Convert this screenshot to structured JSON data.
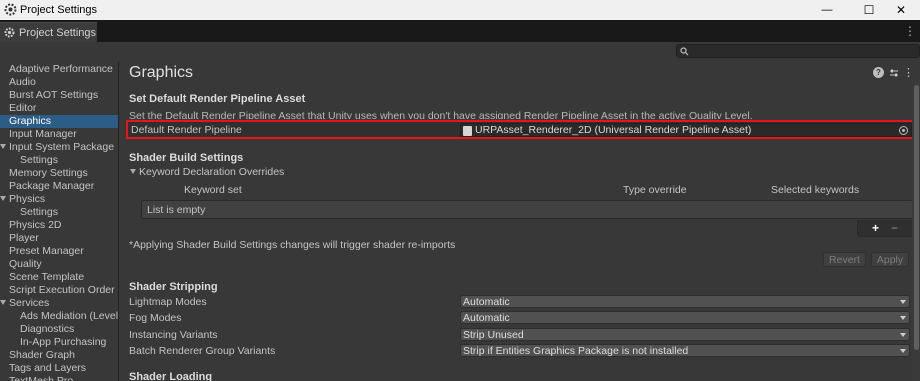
{
  "window": {
    "title": "Project Settings",
    "controls": [
      "—",
      "☐",
      "✕"
    ]
  },
  "tab": {
    "label": "Project Settings",
    "menu": "⋮"
  },
  "sidebar": {
    "items": [
      {
        "label": "Adaptive Performance"
      },
      {
        "label": "Audio"
      },
      {
        "label": "Burst AOT Settings"
      },
      {
        "label": "Editor"
      },
      {
        "label": "Graphics",
        "selected": true
      },
      {
        "label": "Input Manager"
      },
      {
        "label": "Input System Package",
        "expanded": true
      },
      {
        "label": "Settings"
      },
      {
        "label": "Memory Settings"
      },
      {
        "label": "Package Manager"
      },
      {
        "label": "Physics",
        "expanded": true
      },
      {
        "label": "Settings"
      },
      {
        "label": "Physics 2D"
      },
      {
        "label": "Player"
      },
      {
        "label": "Preset Manager"
      },
      {
        "label": "Quality"
      },
      {
        "label": "Scene Template"
      },
      {
        "label": "Script Execution Order"
      },
      {
        "label": "Services",
        "expanded": true
      },
      {
        "label": "Ads Mediation (Level"
      },
      {
        "label": "Diagnostics"
      },
      {
        "label": "In-App Purchasing"
      },
      {
        "label": "Shader Graph"
      },
      {
        "label": "Tags and Layers"
      },
      {
        "label": "TextMesh Pro"
      }
    ]
  },
  "main": {
    "title": "Graphics",
    "render_pipeline": {
      "section": "Set Default Render Pipeline Asset",
      "description": "Set the Default Render Pipeline Asset that Unity uses when you don't have assigned Render Pipeline Asset in the active Quality Level.",
      "label": "Default Render Pipeline",
      "value": "URPAsset_Renderer_2D (Universal Render Pipeline Asset)"
    },
    "shader_build": {
      "section": "Shader Build Settings",
      "foldout": "Keyword Declaration Overrides",
      "columns": [
        "Keyword set",
        "Type override",
        "Selected keywords"
      ],
      "empty": "List is empty",
      "add": "+",
      "remove": "−",
      "note": "*Applying Shader Build Settings changes will trigger shader re-imports",
      "revert": "Revert",
      "apply": "Apply"
    },
    "shader_stripping": {
      "section": "Shader Stripping",
      "rows": [
        {
          "label": "Lightmap Modes",
          "value": "Automatic"
        },
        {
          "label": "Fog Modes",
          "value": "Automatic"
        },
        {
          "label": "Instancing Variants",
          "value": "Strip Unused"
        },
        {
          "label": "Batch Renderer Group Variants",
          "value": "Strip if Entities Graphics Package is not installed"
        }
      ]
    },
    "shader_loading": {
      "section": "Shader Loading"
    }
  }
}
